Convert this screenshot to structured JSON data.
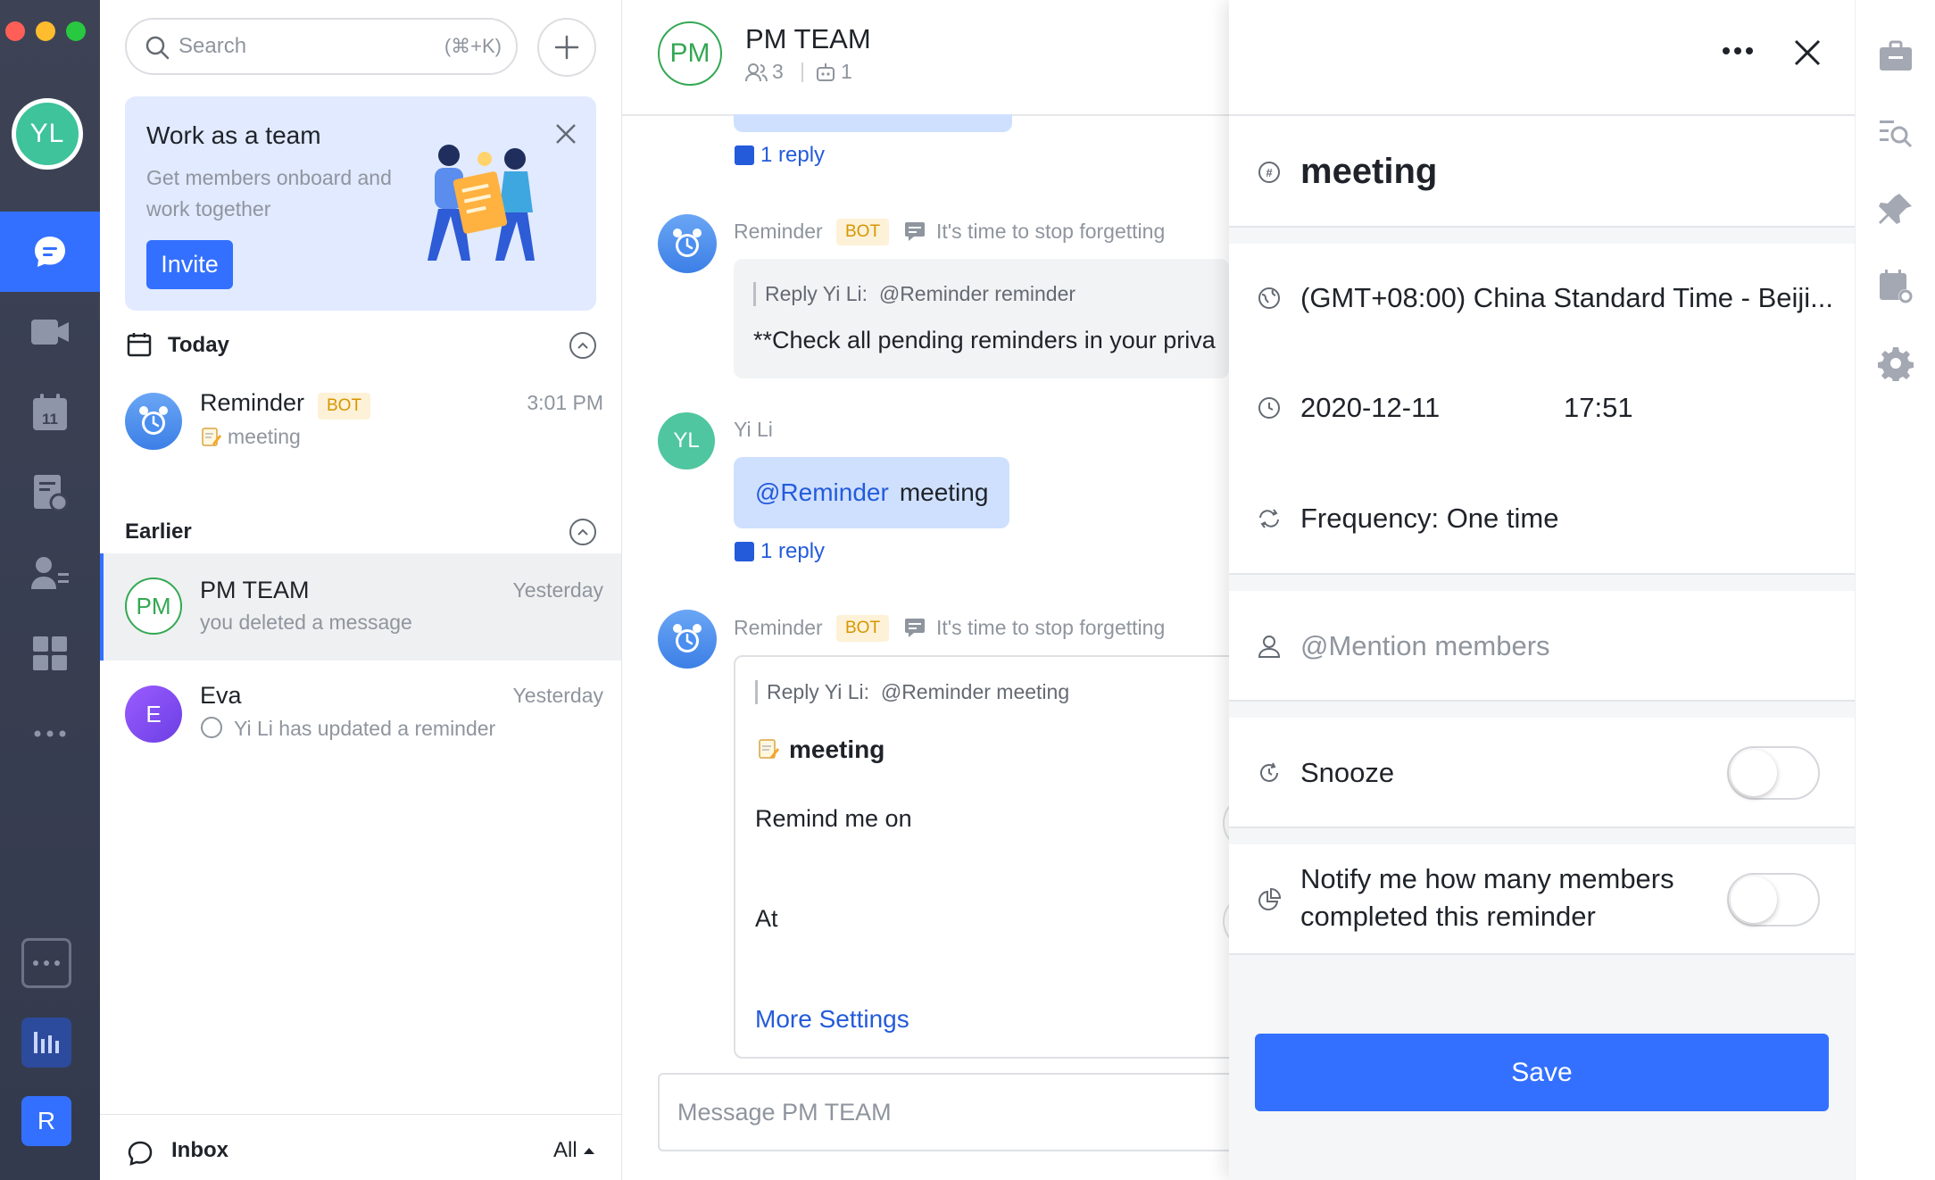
{
  "user": {
    "initials": "YL"
  },
  "rail": {
    "bottom_badge": "R"
  },
  "search": {
    "placeholder": "Search",
    "shortcut": "(⌘+K)"
  },
  "banner": {
    "title": "Work as a team",
    "description": "Get members onboard and work together",
    "invite_label": "Invite"
  },
  "sections": {
    "today": "Today",
    "earlier": "Earlier"
  },
  "chats": [
    {
      "name": "Reminder",
      "tag": "BOT",
      "time": "3:01 PM",
      "preview": "meeting",
      "preview_icon": "memo-emoji"
    },
    {
      "name": "PM TEAM",
      "initials": "PM",
      "time": "Yesterday",
      "preview": "you deleted a message"
    },
    {
      "name": "Eva",
      "initials": "E",
      "time": "Yesterday",
      "preview": "Yi Li has updated a reminder"
    }
  ],
  "inbox": {
    "label": "Inbox",
    "filter": "All"
  },
  "conversation": {
    "title": "PM TEAM",
    "initials": "PM",
    "members": "3",
    "bots": "1",
    "reply_count_1": "1 reply",
    "msg_bot_1": {
      "sender": "Reminder",
      "tag": "BOT",
      "note": "It's time to stop forgetting",
      "quote_prefix": "Reply Yi Li:",
      "quote_text": "@Reminder reminder",
      "body": "**Check all pending reminders in your priva"
    },
    "msg_user": {
      "sender": "Yi Li",
      "initials": "YL",
      "mention": "@Reminder",
      "text": "meeting",
      "reply_count": "1 reply"
    },
    "msg_bot_2": {
      "sender": "Reminder",
      "tag": "BOT",
      "note": "It's time to stop forgetting",
      "quote_prefix": "Reply Yi Li:",
      "quote_text": "@Reminder meeting",
      "title": "meeting",
      "remind_label": "Remind me on",
      "at_label": "At",
      "more_settings": "More Settings"
    },
    "composer_placeholder": "Message PM TEAM"
  },
  "panel": {
    "title": "meeting",
    "timezone": "(GMT+08:00) China Standard Time - Beiji...",
    "date": "2020-12-11",
    "time": "17:51",
    "frequency": "Frequency: One time",
    "mention_placeholder": "@Mention members",
    "snooze_label": "Snooze",
    "snooze_on": false,
    "notify_label": "Notify me how many members completed this reminder",
    "notify_on": false,
    "save_label": "Save"
  },
  "colors": {
    "accent": "#3370ff",
    "rail": "#3d4355",
    "bot_tag_bg": "#fdf1d7",
    "bot_tag_text": "#d59700",
    "pm_green": "#34a853",
    "eva_purple": "#7c4dff"
  }
}
